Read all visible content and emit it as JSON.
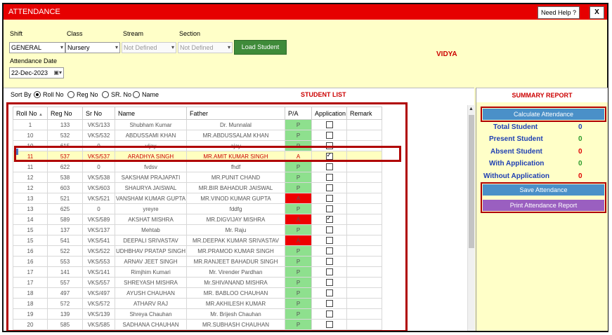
{
  "window": {
    "title": "ATTENDANCE",
    "help_label": "Need Help ?",
    "close_label": "X"
  },
  "filters": {
    "shift_label": "Shift",
    "shift_value": "GENERAL",
    "class_label": "Class",
    "class_value": "Nursery",
    "stream_label": "Stream",
    "stream_value": "Not Defined",
    "section_label": "Section",
    "section_value": "Not Defined",
    "load_label": "Load Student",
    "date_label": "Attendance Date",
    "date_value": "22-Dec-2023"
  },
  "school_name": "VIDYA",
  "sort": {
    "label": "Sort By",
    "options": [
      "Roll No",
      "Reg No",
      "SR. No",
      "Name"
    ],
    "selected": "Roll No"
  },
  "student_list_label": "STUDENT LIST",
  "grid": {
    "columns": [
      "Roll No",
      "Reg No",
      "Sr No",
      "Name",
      "Father",
      "P/A",
      "Application",
      "Remark"
    ],
    "sort_indicator": "▲",
    "rows": [
      {
        "roll": "1",
        "reg": "133",
        "sr": "VKS/133",
        "name": "Shubham Kumar",
        "father": "Dr. Munnalal",
        "pa": "P",
        "app": false
      },
      {
        "roll": "10",
        "reg": "532",
        "sr": "VKS/532",
        "name": "ABDUSSAMI KHAN",
        "father": "MR.ABDUSSALAM KHAN",
        "pa": "P",
        "app": false
      },
      {
        "roll": "10",
        "reg": "615",
        "sr": "0",
        "name": "vijay",
        "father": "ajay",
        "pa": "P",
        "app": false
      },
      {
        "roll": "11",
        "reg": "537",
        "sr": "VKS/537",
        "name": "ARADHYA SINGH",
        "father": "MR.AMIT KUMAR SINGH",
        "pa": "A",
        "app": true,
        "selected": true
      },
      {
        "roll": "11",
        "reg": "622",
        "sr": "0",
        "name": "fvdsv",
        "father": "fhdf",
        "pa": "P",
        "app": false
      },
      {
        "roll": "12",
        "reg": "538",
        "sr": "VKS/538",
        "name": "SAKSHAM PRAJAPATI",
        "father": "MR.PUNIT CHAND",
        "pa": "P",
        "app": false
      },
      {
        "roll": "12",
        "reg": "603",
        "sr": "VKS/603",
        "name": "SHAURYA JAISWAL",
        "father": "MR.BIR BAHADUR JAISWAL",
        "pa": "P",
        "app": false
      },
      {
        "roll": "13",
        "reg": "521",
        "sr": "VKS/521",
        "name": "VANSHAM KUMAR GUPTA",
        "father": "MR.VINOD KUMAR GUPTA",
        "pa": "A",
        "app": false
      },
      {
        "roll": "13",
        "reg": "625",
        "sr": "0",
        "name": "yreyre",
        "father": "fddfg",
        "pa": "P",
        "app": false
      },
      {
        "roll": "14",
        "reg": "589",
        "sr": "VKS/589",
        "name": "AKSHAT MISHRA",
        "father": "MR.DIGVIJAY MISHRA",
        "pa": "A",
        "app": true
      },
      {
        "roll": "15",
        "reg": "137",
        "sr": "VKS/137",
        "name": "Mehtab",
        "father": "Mr. Raju",
        "pa": "P",
        "app": false
      },
      {
        "roll": "15",
        "reg": "541",
        "sr": "VKS/541",
        "name": "DEEPALI SRIVASTAV",
        "father": "MR.DEEPAK KUMAR SRIVASTAV",
        "pa": "A",
        "app": false
      },
      {
        "roll": "16",
        "reg": "522",
        "sr": "VKS/522",
        "name": "UDHBHAV PRATAP SINGH",
        "father": "MR.PRAMOD KUMAR SINGH",
        "pa": "P",
        "app": false
      },
      {
        "roll": "16",
        "reg": "553",
        "sr": "VKS/553",
        "name": "ARNAV JEET SINGH",
        "father": "MR.RANJEET BAHADUR SINGH",
        "pa": "P",
        "app": false
      },
      {
        "roll": "17",
        "reg": "141",
        "sr": "VKS/141",
        "name": "Rimjhim Kumari",
        "father": "Mr. Virender Pardhan",
        "pa": "P",
        "app": false
      },
      {
        "roll": "17",
        "reg": "557",
        "sr": "VKS/557",
        "name": "SHREYASH MISHRA",
        "father": "Mr.SHIVANAND MISHRA",
        "pa": "P",
        "app": false
      },
      {
        "roll": "18",
        "reg": "497",
        "sr": "VKS/497",
        "name": "AYUSH CHAUHAN",
        "father": "MR. BABLOO CHAUHAN",
        "pa": "P",
        "app": false
      },
      {
        "roll": "18",
        "reg": "572",
        "sr": "VKS/572",
        "name": "ATHARV RAJ",
        "father": "MR.AKHILESH KUMAR",
        "pa": "P",
        "app": false
      },
      {
        "roll": "19",
        "reg": "139",
        "sr": "VKS/139",
        "name": "Shreya Chauhan",
        "father": "Mr. Brijesh Chauhan",
        "pa": "P",
        "app": false
      },
      {
        "roll": "20",
        "reg": "585",
        "sr": "VKS/585",
        "name": "SADHANA CHAUHAN",
        "father": "MR.SUBHASH CHAUHAN",
        "pa": "P",
        "app": false
      }
    ]
  },
  "summary": {
    "title": "SUMMARY REPORT",
    "calculate_label": "Calculate Attendance",
    "save_label": "Save Attendance",
    "print_label": "Print Attendance Report",
    "stats": [
      {
        "label": "Total Student",
        "value": "0",
        "color": "#1f3fb3"
      },
      {
        "label": "Present Student",
        "value": "0",
        "color": "#2a9a2a"
      },
      {
        "label": "Absent Student",
        "value": "0",
        "color": "#e00000"
      },
      {
        "label": "With Application",
        "value": "0",
        "color": "#2a9a2a"
      },
      {
        "label": "Without Application",
        "value": "0",
        "color": "#e00000"
      }
    ]
  },
  "colors": {
    "title_bar": "#e60000",
    "load_button": "#3f8b3a",
    "calculate_button": "#4a90c8",
    "save_button": "#4a90c8",
    "print_button": "#9a5fc0",
    "present": "#8ee08e",
    "absent": "#ee0000",
    "highlight": "#b00000"
  }
}
